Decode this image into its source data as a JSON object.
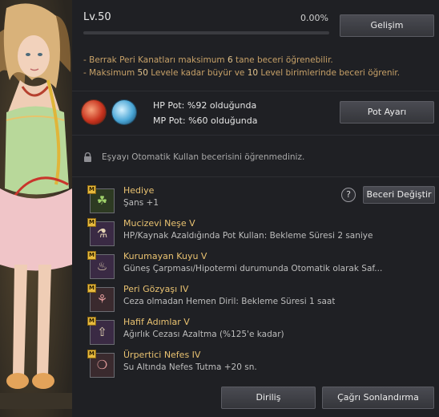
{
  "level": {
    "label": "Lv.",
    "value": "50",
    "percent": "0.00%",
    "progress": 0
  },
  "buttons": {
    "develop": "Gelişim",
    "pot_settings": "Pot Ayarı",
    "skill_change": "Beceri Değiştir",
    "revive": "Diriliş",
    "end_summon": "Çağrı Sonlandırma"
  },
  "notes": [
    {
      "prefix": "- Berrak Peri Kanatları maksimum ",
      "num1": "6",
      "suffix": " tane beceri öğrenebilir.",
      "num2": "",
      "tail": ""
    },
    {
      "prefix": "- Maksimum ",
      "num1": "50",
      "suffix": " Levele kadar büyür ve ",
      "num2": "10",
      "tail": " Level birimlerinde beceri öğrenir."
    }
  ],
  "potions": {
    "hp": "HP Pot: %92 olduğunda",
    "mp": "MP Pot: %60 olduğunda"
  },
  "auto_use": {
    "text": "Eşyayı Otomatik Kullan becerisini öğrenmediniz."
  },
  "help": {
    "symbol": "?"
  },
  "skills": [
    {
      "badge": "M",
      "name": "Hediye",
      "desc": "Şans +1",
      "icon": "clover-icon",
      "glyph": "☘"
    },
    {
      "badge": "M",
      "name": "Mucizevi Neşe V",
      "desc": "HP/Kaynak Azaldığında Pot Kullan: Bekleme Süresi 2 saniye",
      "icon": "potion-plus-icon",
      "glyph": "⚗"
    },
    {
      "badge": "M",
      "name": "Kurumayan Kuyu V",
      "desc": "Güneş Çarpması/Hipotermi durumunda Otomatik olarak Saf...",
      "icon": "well-icon",
      "glyph": "♨"
    },
    {
      "badge": "M",
      "name": "Peri Gözyaşı IV",
      "desc": "Ceza olmadan Hemen Diril: Bekleme Süresi 1 saat",
      "icon": "sprout-icon",
      "glyph": "⚘"
    },
    {
      "badge": "M",
      "name": "Hafif Adımlar V",
      "desc": "Ağırlık Cezası Azaltma (%125'e kadar)",
      "icon": "weight-icon",
      "glyph": "⇧"
    },
    {
      "badge": "M",
      "name": "Ürpertici Nefes IV",
      "desc": "Su Altında Nefes Tutma +20 sn.",
      "icon": "breath-icon",
      "glyph": "❍"
    }
  ],
  "colors": {
    "accent_text": "#c7a168",
    "skill_name": "#e9c271",
    "badge": "#e6b93d"
  }
}
